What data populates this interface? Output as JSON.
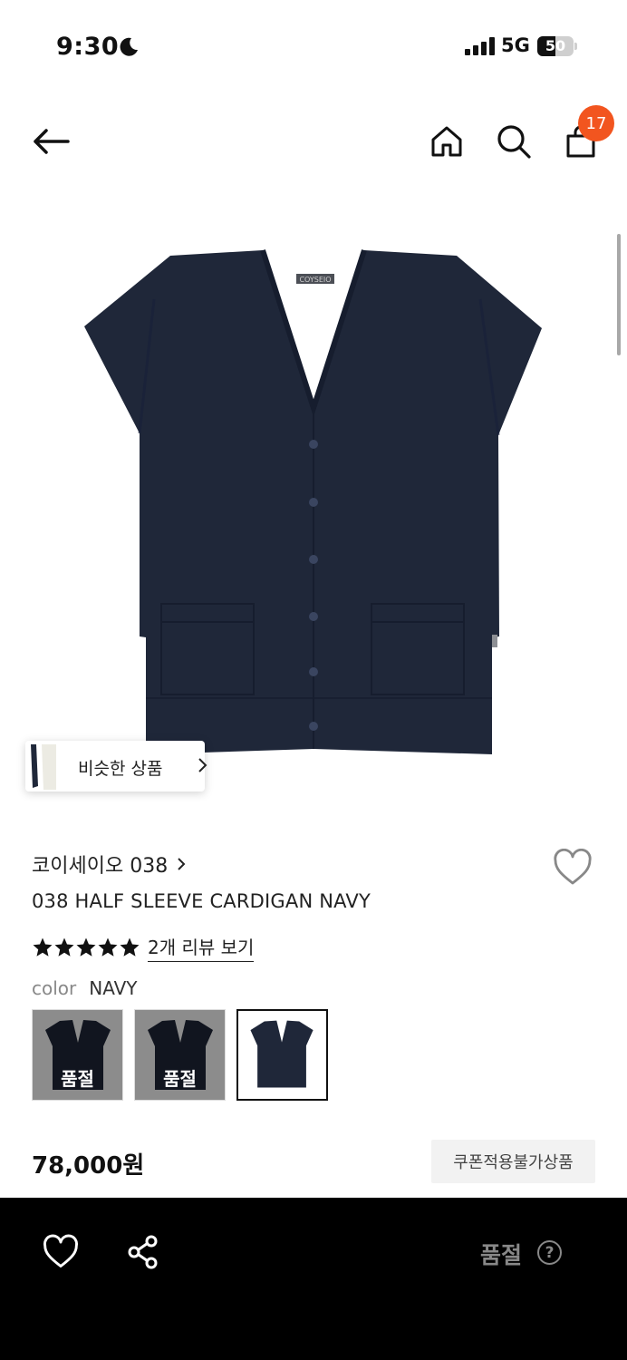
{
  "status_bar": {
    "time": "9:30",
    "network": "5G",
    "battery": "50",
    "battery_level": 0.5
  },
  "header": {
    "cart_count": "17"
  },
  "similar": {
    "label": "비슷한 상품"
  },
  "product": {
    "brand": "코이세이오 038",
    "name": "038 HALF SLEEVE CARDIGAN NAVY",
    "rating": 5,
    "review_link": "2개 리뷰 보기",
    "color_label": "color",
    "color_value": "NAVY",
    "garment_tag": "COYSEIO",
    "swatches": [
      {
        "sold_out": "품절"
      },
      {
        "sold_out": "품절"
      },
      {
        "sold_out": ""
      }
    ],
    "price": "78,000원",
    "coupon": "쿠폰적용불가상품"
  },
  "bottom_bar": {
    "sold_out": "품절",
    "help": "?"
  },
  "colors": {
    "accent": "#f2551f",
    "navy": "#1f2739",
    "bottom_bar": "#000000"
  }
}
